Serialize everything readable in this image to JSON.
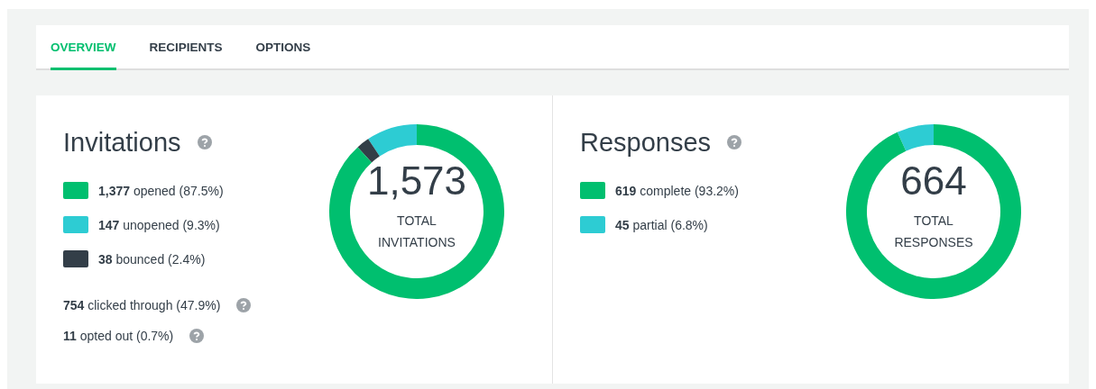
{
  "tabs": [
    {
      "label": "OVERVIEW",
      "selected": true
    },
    {
      "label": "RECIPIENTS",
      "selected": false
    },
    {
      "label": "OPTIONS",
      "selected": false
    }
  ],
  "panels": [
    {
      "title": "Invitations",
      "legend": [
        {
          "count": "1,377",
          "share": "(87.5%)",
          "color": "#00bf6f"
        },
        {
          "count": "147",
          "share": "(9.3%)",
          "color": "#2dccd3"
        },
        {
          "count": "38",
          "share": "(2.4%)",
          "color": "#333e48"
        }
      ],
      "stats": [
        "**754** clicked through (47.9%)",
        "**11** opted out (0.7%)"
      ],
      "total": "1,573",
      "total_label": "TOTAL INVITATIONS",
      "chart_data": {
        "type": "donut",
        "categories": [
          "opened",
          "unopened",
          "bounced"
        ],
        "values": [
          87.5,
          9.3,
          2.4
        ]
      }
    },
    {
      "title": "Responses",
      "legend": [
        {
          "count": "619",
          "share": "(93.2%)",
          "color": "#00bf6f"
        },
        {
          "count": "45",
          "share": "(6.8%)",
          "color": "#2dccd3"
        }
      ],
      "total": "664",
      "total_label": "TOTAL RESPONSES",
      "chart_data": {
        "type": "donut",
        "categories": [
          "complete",
          "partial"
        ],
        "values": [
          93.2,
          6.8
        ]
      }
    }
  ]
}
